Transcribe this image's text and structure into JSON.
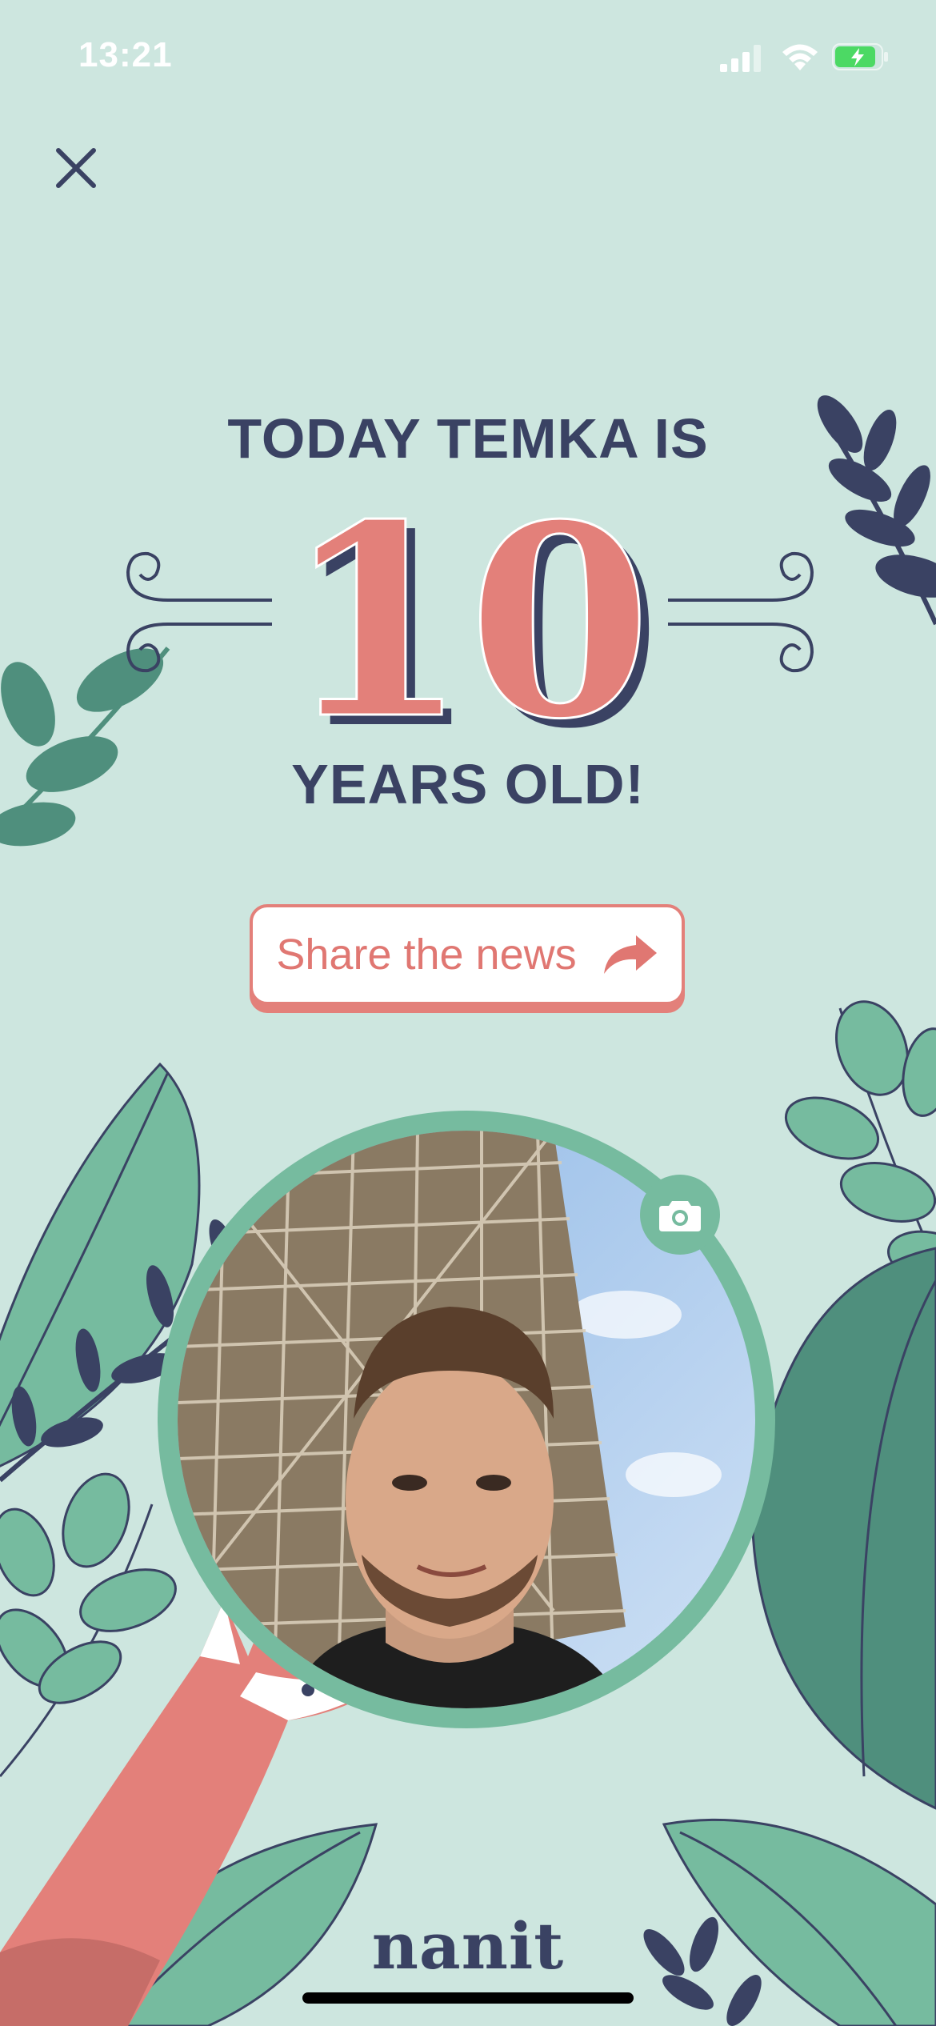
{
  "status_bar": {
    "time": "13:21"
  },
  "headline": {
    "top": "TODAY TEMKA IS",
    "age": "10",
    "bottom": "YEARS OLD!"
  },
  "share": {
    "label": "Share the news",
    "icon": "share-arrow-icon"
  },
  "photo": {
    "camera_icon": "camera-icon"
  },
  "brand": {
    "name": "nanit"
  },
  "colors": {
    "background": "#cde6df",
    "navy": "#3a4263",
    "coral": "#e3807a",
    "leaf_green": "#76bb9f",
    "dark_green": "#4f8f7d"
  }
}
